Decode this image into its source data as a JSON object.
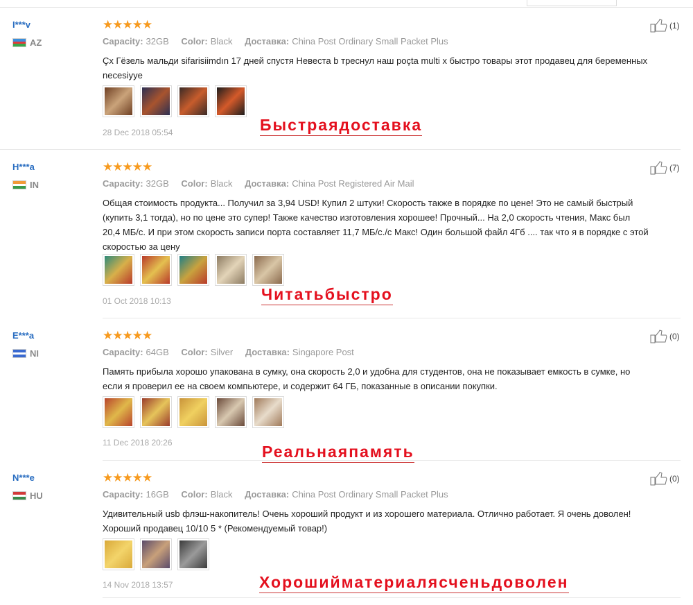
{
  "reviews": [
    {
      "user": "I***v",
      "country": "AZ",
      "flag": [
        "#3a8fdc",
        "#e23a3a",
        "#3aa74a"
      ],
      "stars": "★★★★★",
      "capacity_label": "Capacity:",
      "capacity": "32GB",
      "color_label": "Color:",
      "color": "Black",
      "shipping_label": "Доставка:",
      "shipping": "China Post Ordinary Small Packet Plus",
      "text": "Çх Гёзель мальди sifarisiimdın 17 дней спустя Невеста b треснул наш poçta multi x быстро товары этот продавец для беременных necesiyye",
      "photos": [
        [
          "#6e3f23",
          "#caa37a"
        ],
        [
          "#2c2f52",
          "#a8542e"
        ],
        [
          "#3a2a26",
          "#c75c2c"
        ],
        [
          "#1d1d1d",
          "#d45a2a"
        ]
      ],
      "date": "28 Dec 2018 05:54",
      "likes": "(1)",
      "overlay": "Быстраядоставка"
    },
    {
      "user": "H***a",
      "country": "IN",
      "flag": [
        "#f29a38",
        "#ffffff",
        "#3a9a4a"
      ],
      "stars": "★★★★★",
      "capacity_label": "Capacity:",
      "capacity": "32GB",
      "color_label": "Color:",
      "color": "Black",
      "shipping_label": "Доставка:",
      "shipping": "China Post Registered Air Mail",
      "text": "Общая стоимость продукта... Получил за 3,94 USD! Купил 2 штуки! Скорость также в порядке по цене! Это не самый быстрый (купить 3,1 тогда), но по цене это супер! Также качество изготовления хорошее! Прочный... На 2,0 скорость чтения, Макс был 20,4 МБ/с. И при этом скорость записи порта составляет 11,7 МБ/с./с Макс! Один большой файл 4Гб .... так что я в порядке с этой скоростью за цену",
      "photos": [
        [
          "#2c8a7a",
          "#d8b04a"
        ],
        [
          "#b83a2a",
          "#e4c050"
        ],
        [
          "#1f7f86",
          "#c9a23e"
        ],
        [
          "#8c7b62",
          "#e3d4b8"
        ],
        [
          "#8a6a4e",
          "#d9c6a6"
        ]
      ],
      "date": "01 Oct 2018 10:13",
      "likes": "(7)",
      "overlay": "Читатьбыстро"
    },
    {
      "user": "E***a",
      "country": "NI",
      "flag": [
        "#3a6ad0",
        "#ffffff",
        "#3a6ad0"
      ],
      "stars": "★★★★★",
      "capacity_label": "Capacity:",
      "capacity": "64GB",
      "color_label": "Color:",
      "color": "Silver",
      "shipping_label": "Доставка:",
      "shipping": "Singapore Post",
      "text": "Память прибыла хорошо упакована в сумку, она скорость 2,0 и удобна для студентов, она не показывает емкость в сумке, но если я проверил ее на своем компьютере, и содержит 64 ГБ, показанные в описании покупки.",
      "photos": [
        [
          "#b8442c",
          "#e0b84a"
        ],
        [
          "#9b3c2c",
          "#e6c45a"
        ],
        [
          "#c9943a",
          "#f0d060"
        ],
        [
          "#6a4a3a",
          "#d8c8b0"
        ],
        [
          "#a07a5a",
          "#e8dccb"
        ]
      ],
      "date": "11 Dec 2018 20:26",
      "likes": "(0)",
      "overlay": "Реальнаяпамять"
    },
    {
      "user": "N***e",
      "country": "HU",
      "flag": [
        "#d23a3a",
        "#ffffff",
        "#3a8a4a"
      ],
      "stars": "★★★★★",
      "capacity_label": "Capacity:",
      "capacity": "16GB",
      "color_label": "Color:",
      "color": "Black",
      "shipping_label": "Доставка:",
      "shipping": "China Post Ordinary Small Packet Plus",
      "text": "Удивительный usb флэш-накопитель! Очень хороший продукт и из хорошего материала. Отлично работает. Я очень доволен! Хороший продавец 10/10 5 * (Рекомендуемый товар!)",
      "photos": [
        [
          "#d9a93a",
          "#f3d46a"
        ],
        [
          "#5a4a6a",
          "#c8a07a"
        ],
        [
          "#3a3a3a",
          "#9a9a9a"
        ]
      ],
      "date": "14 Nov 2018 13:57",
      "likes": "(0)",
      "overlay": "Хорошийматериалясченьдоволен"
    }
  ]
}
